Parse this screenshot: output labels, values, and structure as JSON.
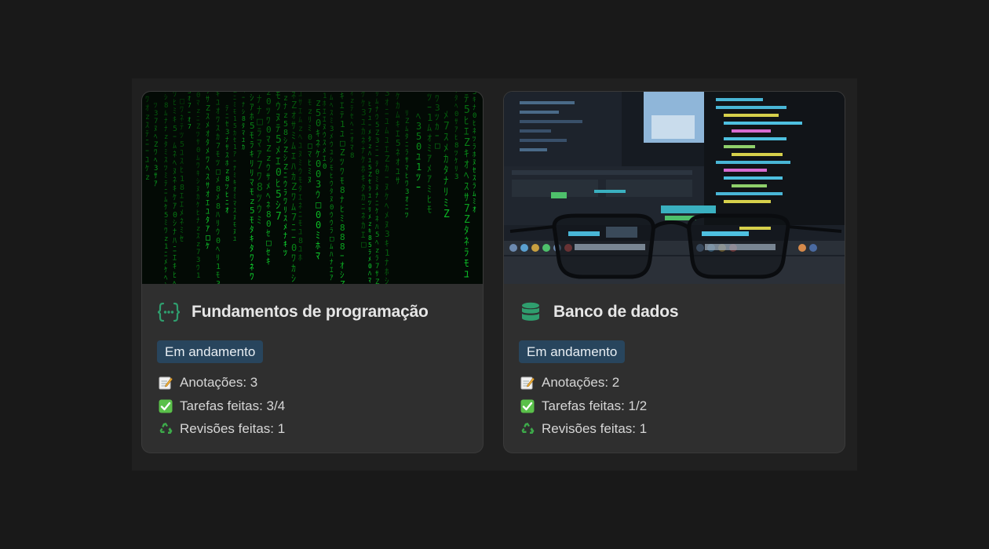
{
  "cards": [
    {
      "title": "Fundamentos de programação",
      "icon": "code-braces-icon",
      "cover": "matrix-code-image",
      "status": "Em andamento",
      "status_color": "#28455d",
      "annotations_label": "Anotações: 3",
      "tasks_label": "Tarefas feitas: 3/4",
      "reviews_label": "Revisões feitas: 1"
    },
    {
      "title": "Banco de dados",
      "icon": "database-icon",
      "cover": "monitor-glasses-image",
      "status": "Em andamento",
      "status_color": "#28455d",
      "annotations_label": "Anotações: 2",
      "tasks_label": "Tarefas feitas: 1/2",
      "reviews_label": "Revisões feitas: 1"
    }
  ],
  "colors": {
    "background": "#191919",
    "board": "#202020",
    "card": "#2f2f2f",
    "accent_green": "#2f9e6e"
  }
}
